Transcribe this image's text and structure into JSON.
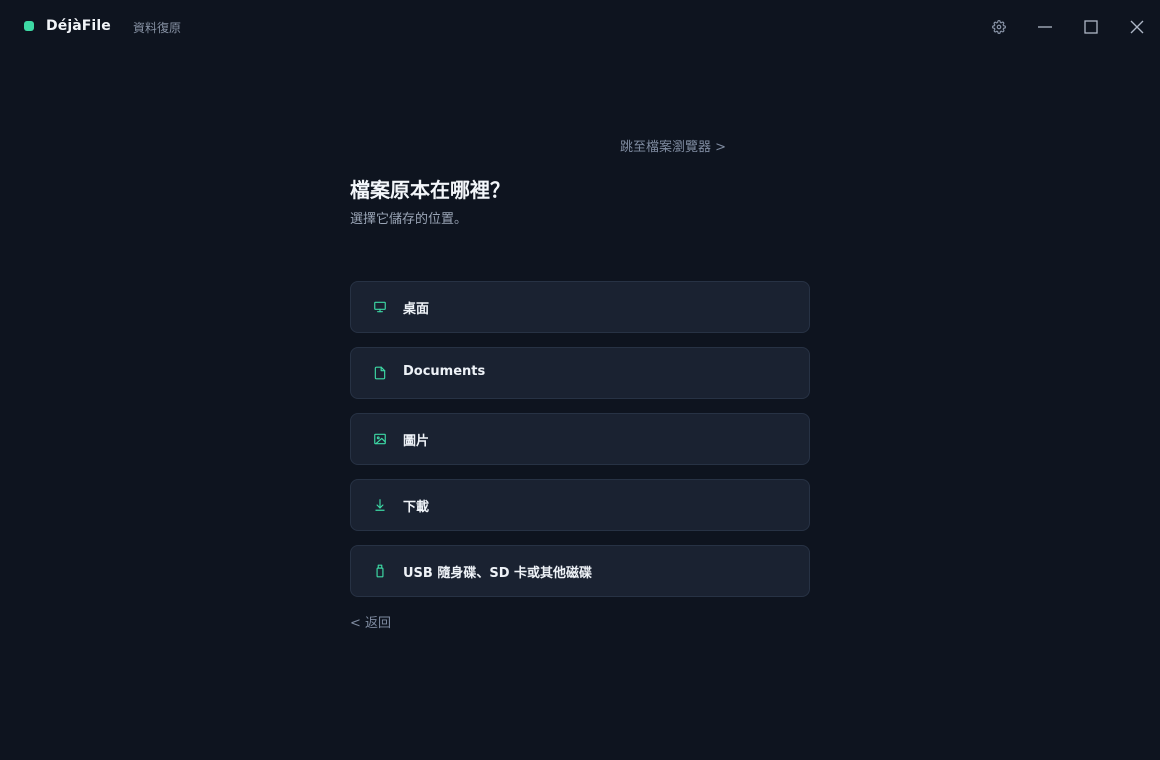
{
  "app": {
    "name": "DéjàFile",
    "subtitle": "資料復原"
  },
  "window_controls": {
    "settings_icon": "gear-icon",
    "minimize_icon": "minimize-icon",
    "maximize_icon": "maximize-icon",
    "close_icon": "close-icon"
  },
  "main": {
    "jump_link": "跳至檔案瀏覽器 >",
    "title": "檔案原本在哪裡？",
    "subtitle": "選擇它儲存的位置。",
    "back_link": "< 返回"
  },
  "locations": [
    {
      "label": "桌面",
      "icon": "monitor-icon"
    },
    {
      "label": "Documents",
      "icon": "document-icon"
    },
    {
      "label": "圖片",
      "icon": "image-icon"
    },
    {
      "label": "下載",
      "icon": "download-icon"
    },
    {
      "label": "USB 隨身碟、SD 卡或其他磁碟",
      "icon": "usb-drive-icon"
    }
  ],
  "colors": {
    "background": "#0e141f",
    "card": "#1a2231",
    "card_border": "#273244",
    "accent": "#3dd9a4",
    "muted_text": "#7f8ba0"
  }
}
